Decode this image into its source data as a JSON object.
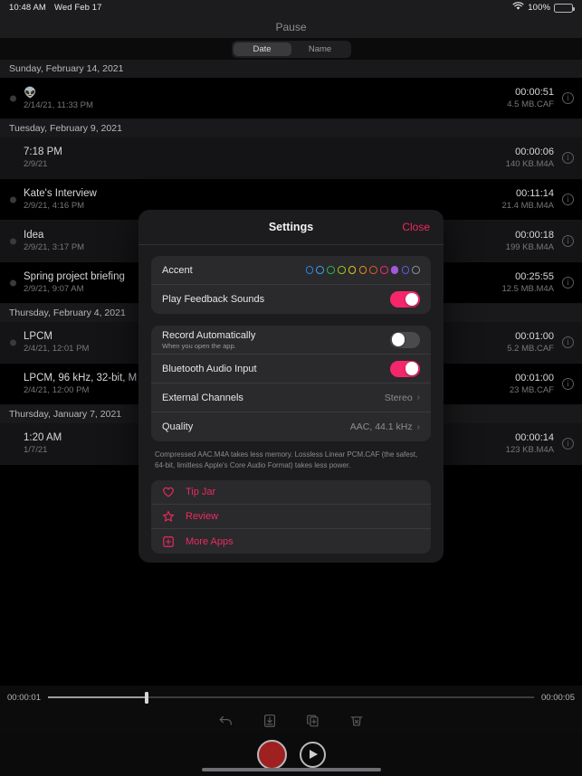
{
  "status_bar": {
    "time": "10:48 AM",
    "date": "Wed Feb 17",
    "battery_percent": "100%",
    "wifi_icon": "wifi-icon",
    "battery_icon": "battery-full-icon"
  },
  "nav": {
    "title": "Pause"
  },
  "sort_control": {
    "options": [
      {
        "label": "Date",
        "selected": true
      },
      {
        "label": "Name",
        "selected": false
      }
    ]
  },
  "list": {
    "sections": [
      {
        "header": "Sunday, February 14, 2021",
        "rows": [
          {
            "name": "👽",
            "date": "2/14/21, 11:33 PM",
            "duration": "00:00:51",
            "size": "4.5 MB.CAF",
            "dot": true,
            "shade": "dark"
          }
        ]
      },
      {
        "header": "Tuesday, February 9, 2021",
        "rows": [
          {
            "name": "7:18 PM",
            "date": "2/9/21",
            "duration": "00:00:06",
            "size": "140 KB.M4A",
            "dot": false,
            "shade": "lite"
          },
          {
            "name": "Kate's Interview",
            "date": "2/9/21, 4:16 PM",
            "duration": "00:11:14",
            "size": "21.4 MB.M4A",
            "dot": true,
            "shade": "dark"
          },
          {
            "name": "Idea",
            "date": "2/9/21, 3:17 PM",
            "duration": "00:00:18",
            "size": "199 KB.M4A",
            "dot": true,
            "shade": "lite"
          },
          {
            "name": "Spring project briefing",
            "date": "2/9/21, 9:07 AM",
            "duration": "00:25:55",
            "size": "12.5 MB.M4A",
            "dot": true,
            "shade": "dark"
          }
        ]
      },
      {
        "header": "Thursday, February 4, 2021",
        "rows": [
          {
            "name": "LPCM",
            "date": "2/4/21, 12:01 PM",
            "duration": "00:01:00",
            "size": "5.2 MB.CAF",
            "dot": true,
            "shade": "lite"
          },
          {
            "name": "LPCM, 96 kHz, 32-bit, M",
            "date": "2/4/21, 12:00 PM",
            "duration": "00:01:00",
            "size": "23 MB.CAF",
            "dot": false,
            "shade": "dark"
          }
        ]
      },
      {
        "header": "Thursday, January 7, 2021",
        "rows": [
          {
            "name": "1:20 AM",
            "date": "1/7/21",
            "duration": "00:00:14",
            "size": "123 KB.M4A",
            "dot": false,
            "shade": "lite"
          }
        ]
      }
    ]
  },
  "settings_modal": {
    "title": "Settings",
    "close_label": "Close",
    "accent": {
      "label": "Accent",
      "selected_index": 8,
      "colors": [
        "#2f7fe0",
        "#3fa0e8",
        "#2bb24c",
        "#9ec31f",
        "#ddc32a",
        "#e08b1e",
        "#d95a2b",
        "#f5276a",
        "#a05ad8",
        "#5b5ce0",
        "#8e8e93"
      ]
    },
    "play_feedback_sounds": {
      "label": "Play Feedback Sounds",
      "value": "on"
    },
    "record_automatically": {
      "label": "Record Automatically",
      "sublabel": "When you open the app.",
      "value": "off"
    },
    "bluetooth_audio_input": {
      "label": "Bluetooth Audio Input",
      "value": "on"
    },
    "external_channels": {
      "label": "External Channels",
      "value": "Stereo"
    },
    "quality": {
      "label": "Quality",
      "value": "AAC, 44.1 kHz"
    },
    "footer_note": "Compressed AAC.M4A takes less memory. Lossless Linear PCM.CAF (the safest, 64-bit, limitless Apple's Core Audio Format) takes less power.",
    "actions": [
      {
        "label": "Tip Jar",
        "icon": "heart-icon"
      },
      {
        "label": "Review",
        "icon": "star-icon"
      },
      {
        "label": "More Apps",
        "icon": "apps-grid-icon"
      }
    ],
    "accent_color": "#ec2a5e"
  },
  "player": {
    "elapsed": "00:00:01",
    "total": "00:00:05",
    "toolbar": [
      {
        "icon": "undo-icon"
      },
      {
        "icon": "save-download-icon"
      },
      {
        "icon": "duplicate-icon"
      },
      {
        "icon": "trash-delete-icon"
      }
    ],
    "record_button": "record-button",
    "play_button": "play-button",
    "record_color": "#9e2020"
  }
}
